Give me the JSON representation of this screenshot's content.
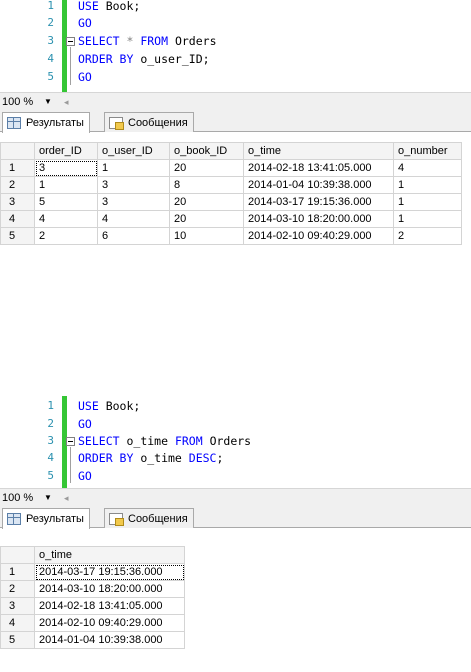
{
  "panel1": {
    "code": {
      "line_numbers": [
        "1",
        "2",
        "3",
        "4",
        "5"
      ],
      "l1_kw": "USE",
      "l1_rest": " Book;",
      "l2_kw": "GO",
      "l3_kw1": "SELECT",
      "l3_star": " * ",
      "l3_kw2": "FROM",
      "l3_rest": " Orders",
      "l4_kw": "ORDER BY",
      "l4_rest": " o_user_ID;",
      "l5_kw": "GO"
    },
    "zoom": "100 %",
    "tabs": {
      "results": "Результаты",
      "messages": "Сообщения"
    },
    "grid": {
      "columns": [
        "order_ID",
        "o_user_ID",
        "o_book_ID",
        "o_time",
        "o_number"
      ],
      "rows": [
        [
          "1",
          "3",
          "1",
          "20",
          "2014-02-18 13:41:05.000",
          "4"
        ],
        [
          "2",
          "1",
          "3",
          "8",
          "2014-01-04 10:39:38.000",
          "1"
        ],
        [
          "3",
          "5",
          "3",
          "20",
          "2014-03-17 19:15:36.000",
          "1"
        ],
        [
          "4",
          "4",
          "4",
          "20",
          "2014-03-10 18:20:00.000",
          "1"
        ],
        [
          "5",
          "2",
          "6",
          "10",
          "2014-02-10 09:40:29.000",
          "2"
        ]
      ]
    }
  },
  "panel2": {
    "code": {
      "line_numbers": [
        "1",
        "2",
        "3",
        "4",
        "5"
      ],
      "l1_kw": "USE",
      "l1_rest": " Book;",
      "l2_kw": "GO",
      "l3_kw1": "SELECT",
      "l3_mid": " o_time ",
      "l3_kw2": "FROM",
      "l3_rest": " Orders",
      "l4_kw": "ORDER BY",
      "l4_mid": " o_time ",
      "l4_kw2": "DESC",
      "l4_rest": ";",
      "l5_kw": "GO"
    },
    "zoom": "100 %",
    "tabs": {
      "results": "Результаты",
      "messages": "Сообщения"
    },
    "grid": {
      "columns": [
        "o_time"
      ],
      "rows": [
        [
          "1",
          "2014-03-17 19:15:36.000"
        ],
        [
          "2",
          "2014-03-10 18:20:00.000"
        ],
        [
          "3",
          "2014-02-18 13:41:05.000"
        ],
        [
          "4",
          "2014-02-10 09:40:29.000"
        ],
        [
          "5",
          "2014-01-04 10:39:38.000"
        ]
      ]
    }
  },
  "colors": {
    "keyword": "#0000ff",
    "line_number": "#2b91af",
    "change_bar": "#35c635"
  },
  "icons": [
    "results-grid-icon",
    "messages-icon",
    "zoom-dropdown-icon",
    "scroll-left-icon",
    "collapse-icon"
  ]
}
